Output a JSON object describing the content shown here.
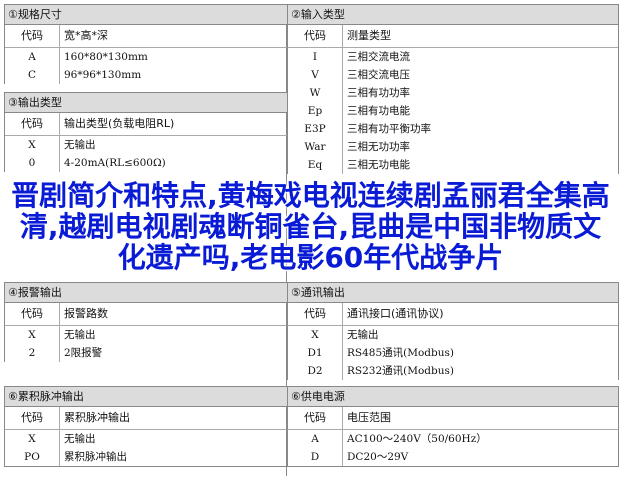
{
  "sections": {
    "s1": {
      "title": "①规格尺寸",
      "code_header": "代码",
      "desc_header": "宽*高*深",
      "rows": [
        {
          "code": "A",
          "desc": "160*80*130mm"
        },
        {
          "code": "C",
          "desc": "96*96*130mm"
        }
      ]
    },
    "s2": {
      "title": "②输入类型",
      "code_header": "代码",
      "desc_header": "测量类型",
      "rows": [
        {
          "code": "I",
          "desc": "三相交流电流"
        },
        {
          "code": "V",
          "desc": "三相交流电压"
        },
        {
          "code": "W",
          "desc": "三相有功功率"
        },
        {
          "code": "Ep",
          "desc": "三相有功电能"
        },
        {
          "code": "E3P",
          "desc": "三相有功平衡功率"
        },
        {
          "code": "War",
          "desc": "三相无功功率"
        },
        {
          "code": "Eq",
          "desc": "三相无功电能"
        }
      ]
    },
    "s3": {
      "title": "③输出类型",
      "code_header": "代码",
      "desc_header": "输出类型(负载电阻RL)",
      "rows": [
        {
          "code": "X",
          "desc": "无输出"
        },
        {
          "code": "0",
          "desc": "4-20mA(RL≤600Ω)"
        }
      ]
    },
    "s4": {
      "title": "④报警输出",
      "code_header": "代码",
      "desc_header": "报警路数",
      "rows": [
        {
          "code": "X",
          "desc": "无输出"
        },
        {
          "code": "2",
          "desc": "2限报警"
        }
      ]
    },
    "s5": {
      "title": "⑤通讯输出",
      "code_header": "代码",
      "desc_header": "通讯接口(通讯协议)",
      "rows": [
        {
          "code": "X",
          "desc": "无输出"
        },
        {
          "code": "D1",
          "desc": "RS485通讯(Modbus)"
        },
        {
          "code": "D2",
          "desc": "RS232通讯(Modbus)"
        }
      ]
    },
    "s6": {
      "title": "⑥累积脉冲输出",
      "code_header": "代码",
      "desc_header": "累积脉冲输出",
      "rows": [
        {
          "code": "X",
          "desc": "无输出"
        },
        {
          "code": "PO",
          "desc": "累积脉冲输出"
        }
      ]
    },
    "s7": {
      "title": "⑥供电电源",
      "code_header": "代码",
      "desc_header": "电压范围",
      "rows": [
        {
          "code": "A",
          "desc": "AC100～240V（50/60Hz）"
        },
        {
          "code": "D",
          "desc": "DC20～29V"
        }
      ]
    }
  },
  "overlay_text": "晋剧简介和特点,黄梅戏电视连续剧孟丽君全集高清,越剧电视剧魂断铜雀台,昆曲是中国非物质文化遗产吗,老电影60年代战争片",
  "colors": {
    "overlay": "#0a1bd6",
    "section_bg": "#dcdcdc"
  }
}
